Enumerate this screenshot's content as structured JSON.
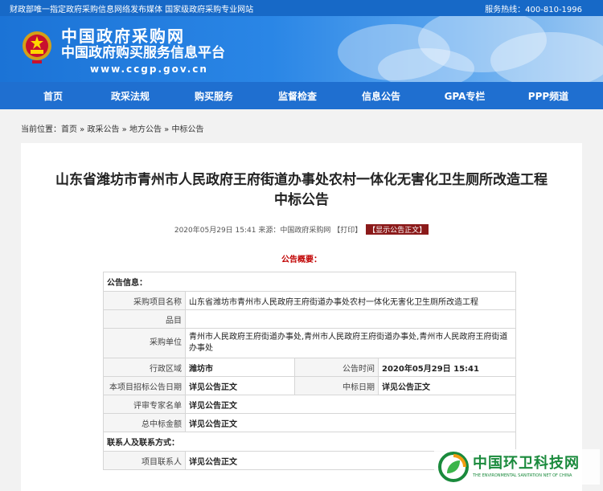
{
  "topbar": {
    "left": "财政部唯一指定政府采购信息网络发布媒体  国家级政府采购专业网站",
    "right": "服务热线：400-810-1996"
  },
  "logo": {
    "line1": "中国政府采购网",
    "line2": "中国政府购买服务信息平台",
    "url": "www.ccgp.gov.cn"
  },
  "nav": [
    "首页",
    "政采法规",
    "购买服务",
    "监督检查",
    "信息公告",
    "GPA专栏",
    "PPP频道"
  ],
  "breadcrumb": {
    "prefix": "当前位置：",
    "items": [
      "首页",
      "政采公告",
      "地方公告",
      "中标公告"
    ],
    "sep": " » "
  },
  "article": {
    "title_line1": "山东省潍坊市青州市人民政府王府街道办事处农村一体化无害化卫生厕所改造工程",
    "title_line2": "中标公告",
    "date": "2020年05月29日 15:41",
    "source": "来源：中国政府采购网",
    "print": "【打印】",
    "show_body": "【显示公告正文】",
    "summary": "公告概要："
  },
  "table": {
    "section1": "公告信息：",
    "project_name_label": "采购项目名称",
    "project_name": "山东省潍坊市青州市人民政府王府街道办事处农村一体化无害化卫生厕所改造工程",
    "item_label": "品目",
    "item": "",
    "unit_label": "采购单位",
    "unit": "青州市人民政府王府街道办事处,青州市人民政府王府街道办事处,青州市人民政府王府街道办事处",
    "region_label": "行政区域",
    "region": "潍坊市",
    "pub_time_label": "公告时间",
    "pub_time": "2020年05月29日 15:41",
    "tender_date_label": "本项目招标公告日期",
    "tender_date": "详见公告正文",
    "award_date_label": "中标日期",
    "award_date": "详见公告正文",
    "experts_label": "评审专家名单",
    "experts": "详见公告正文",
    "amount_label": "总中标金额",
    "amount": "详见公告正文",
    "section2": "联系人及联系方式：",
    "contact_label": "项目联系人",
    "contact": "详见公告正文"
  },
  "watermark": {
    "cn": "中国环卫科技网",
    "en": "THE ENVIRONMENTAL SANITATION NET OF CHINA"
  },
  "colors": {
    "topbar": "#1769c7",
    "nav": "#1f6fd0",
    "accent_red": "#c00000",
    "button_red": "#8b1a1a",
    "watermark_green": "#1a8a3c"
  }
}
